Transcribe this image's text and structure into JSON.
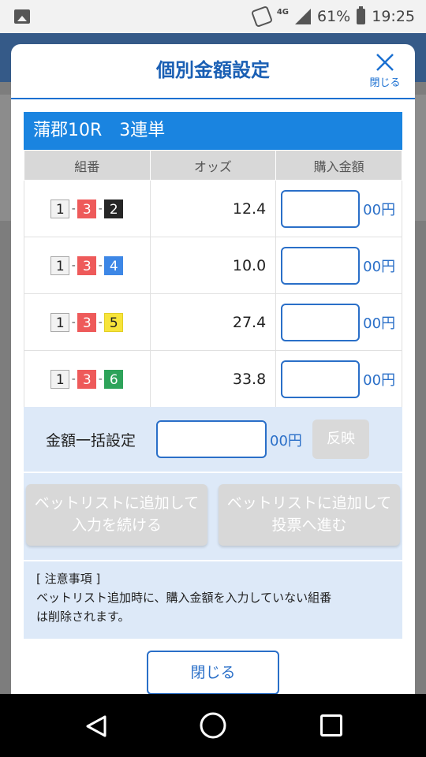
{
  "status_bar": {
    "network": "4G",
    "battery": "61%",
    "time": "19:25"
  },
  "modal": {
    "title": "個別金額設定",
    "close_x_label": "閉じる"
  },
  "race": {
    "name": "蒲郡10R",
    "bet_type": "3連単"
  },
  "table": {
    "headers": [
      "組番",
      "オッズ",
      "購入金額"
    ],
    "unit": "00円",
    "rows": [
      {
        "combo": [
          "1",
          "3",
          "2"
        ],
        "odds": "12.4",
        "amount": ""
      },
      {
        "combo": [
          "1",
          "3",
          "4"
        ],
        "odds": "10.0",
        "amount": ""
      },
      {
        "combo": [
          "1",
          "3",
          "5"
        ],
        "odds": "27.4",
        "amount": ""
      },
      {
        "combo": [
          "1",
          "3",
          "6"
        ],
        "odds": "33.8",
        "amount": ""
      }
    ]
  },
  "bulk": {
    "label": "金額一括設定",
    "unit": "00円",
    "apply_label": "反映",
    "value": ""
  },
  "actions": {
    "continue": {
      "line1": "ベットリストに追加して",
      "line2": "入力を続ける"
    },
    "proceed": {
      "line1": "ベットリストに追加して",
      "line2": "投票へ進む"
    }
  },
  "notice": {
    "title": "[ 注意事項 ]",
    "line1": "ベットリスト追加時に、購入金額を入力していない組番",
    "line2": "は削除されます。"
  },
  "close_button": "閉じる",
  "colors": {
    "accent": "#1a6fd1",
    "race_bar": "#1a84e0",
    "disabled": "#d8d8d8",
    "panel": "#dde9f8"
  }
}
